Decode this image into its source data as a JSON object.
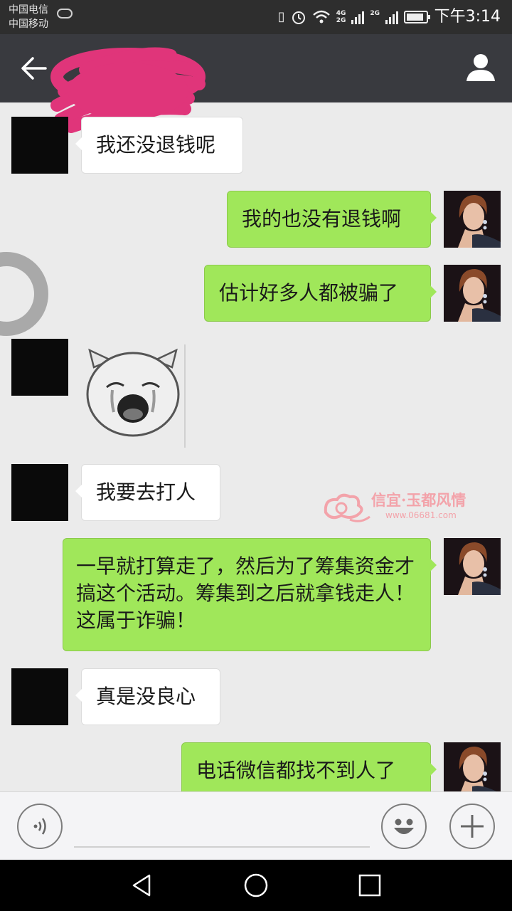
{
  "status_bar": {
    "carrier_1": "中国电信",
    "carrier_2": "中国移动",
    "network_1": "4G",
    "network_2": "2G",
    "network_3": "2G",
    "time": "下午3:14"
  },
  "title_bar": {
    "contact_name_redacted": true
  },
  "messages": [
    {
      "side": "left",
      "text": "我还没退钱呢"
    },
    {
      "side": "right",
      "text": "我的也没有退钱啊"
    },
    {
      "side": "right",
      "text": "估计好多人都被骗了"
    },
    {
      "side": "left",
      "type": "sticker",
      "sticker": "crying-pig-sticker"
    },
    {
      "side": "left",
      "text": "我要去打人"
    },
    {
      "side": "right",
      "text": "一早就打算走了，然后为了筹集资金才搞这个活动。筹集到之后就拿钱走人！这属于诈骗！"
    },
    {
      "side": "left",
      "text": "真是没良心"
    },
    {
      "side": "right",
      "text": "电话微信都找不到人了"
    }
  ],
  "watermark": {
    "title": "信宜·玉都风情",
    "url": "www.06681.com"
  },
  "input_bar": {
    "voice_icon": "voice-icon",
    "emoji_icon": "emoji-icon",
    "plus_icon": "plus-icon"
  },
  "colors": {
    "title_bar": "#393a3f",
    "status_bar": "#2e2e2e",
    "chat_background": "#ebebeb",
    "outgoing_bubble": "#a0e75a",
    "incoming_bubble": "#ffffff",
    "watermark": "#f3a3aa"
  }
}
